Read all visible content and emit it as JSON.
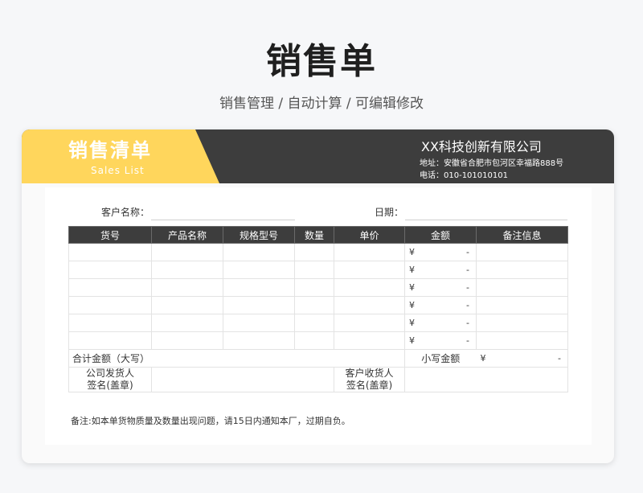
{
  "page": {
    "title": "销售单",
    "subtitle": "销售管理 / 自动计算 /  可编辑修改"
  },
  "banner": {
    "title": "销售清单",
    "subtitle": "Sales List",
    "company": "XX科技创新有限公司",
    "address": "地址：安徽省合肥市包河区幸福路888号",
    "phone": "电话：010-101010101"
  },
  "form": {
    "customer_label": "客户名称：",
    "date_label": "日期："
  },
  "table": {
    "headers": [
      "货号",
      "产品名称",
      "规格型号",
      "数量",
      "单价",
      "金额",
      "备注信息"
    ],
    "currency_symbol": "¥",
    "empty_amount": "-",
    "total_caps_label": "合计金额（大写）",
    "total_small_label": "小写金额",
    "total_small_currency": "¥",
    "total_small_value": "-",
    "company_sign_label": "公司发货人签名(盖章)",
    "company_sign_line1": "公司发货人",
    "company_sign_line2": "签名(盖章)",
    "customer_sign_line1": "客户收货人",
    "customer_sign_line2": "签名(盖章)"
  },
  "note": "备注:如本单货物质量及数量出现问题，请15日内通知本厂，过期自负。",
  "colors": {
    "accent": "#ffd65c",
    "dark": "#3d3d3d"
  }
}
